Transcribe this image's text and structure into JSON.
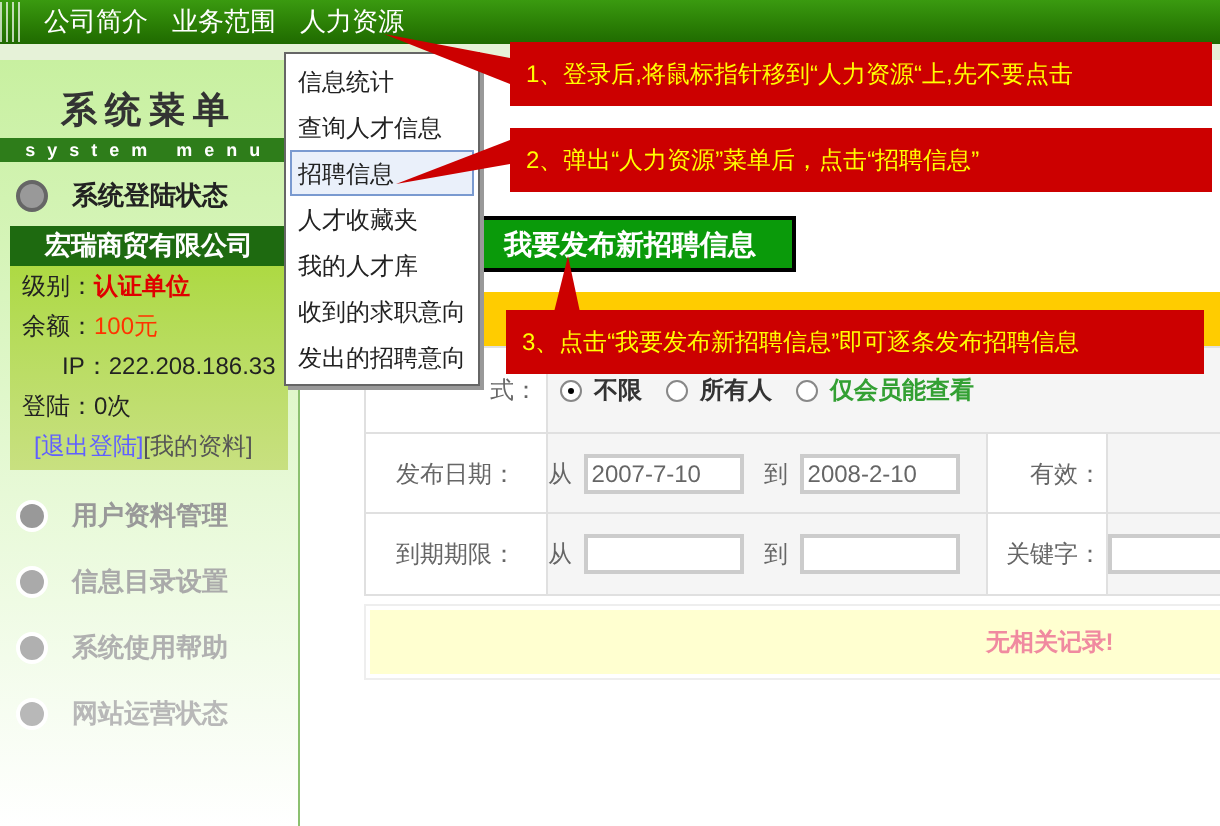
{
  "nav": [
    {
      "label": "公司简介"
    },
    {
      "label": "业务范围"
    },
    {
      "label": "人力资源"
    }
  ],
  "dropdown": [
    {
      "label": "信息统计",
      "selected": false
    },
    {
      "label": "查询人才信息",
      "selected": false
    },
    {
      "label": "招聘信息",
      "selected": true
    },
    {
      "label": "人才收藏夹",
      "selected": false
    },
    {
      "label": "我的人才库",
      "selected": false
    },
    {
      "label": "收到的求职意向",
      "selected": false
    },
    {
      "label": "发出的招聘意向",
      "selected": false
    }
  ],
  "sidebar": {
    "title": "系统菜单",
    "subtitle": "system menu",
    "status": "系统登陆状态",
    "company": "宏瑞商贸有限公司",
    "fields": [
      {
        "label": "级别：",
        "value": "认证单位",
        "kind": "level"
      },
      {
        "label": "余额：",
        "value": "100元",
        "kind": "balance"
      },
      {
        "label": "IP：",
        "value": "222.208.186.33",
        "kind": "plain"
      },
      {
        "label": "登陆：",
        "value": "0次",
        "kind": "plain"
      }
    ],
    "links": [
      "[退出登陆]",
      "[我的资料]"
    ],
    "menu": [
      "用户资料管理",
      "信息目录设置",
      "系统使用帮助",
      "网站运营状态"
    ]
  },
  "publish_button": "我要发布新招聘信息",
  "form": {
    "mode_label": "式：",
    "options": [
      {
        "label": "不限",
        "selected": true,
        "color": "#333333"
      },
      {
        "label": "所有人",
        "selected": false,
        "color": "#333333"
      },
      {
        "label": "仅会员能查看",
        "selected": false,
        "color": "#33a033"
      }
    ],
    "rows": [
      {
        "label": "发布日期：",
        "from_label": "从",
        "from": "2007-7-10",
        "to_label": "到",
        "to": "2008-2-10",
        "extra_label": "有效："
      },
      {
        "label": "到期期限：",
        "from_label": "从",
        "from": "",
        "to_label": "到",
        "to": "",
        "extra_label": "关键字："
      }
    ],
    "empty": "无相关记录!"
  },
  "callouts": [
    "1、登录后,将鼠标指针移到“人力资源“上,先不要点击",
    "2、弹出“人力资源”菜单后，点击“招聘信息”",
    "3、点击“我要发布新招聘信息”即可逐条发布招聘信息"
  ]
}
